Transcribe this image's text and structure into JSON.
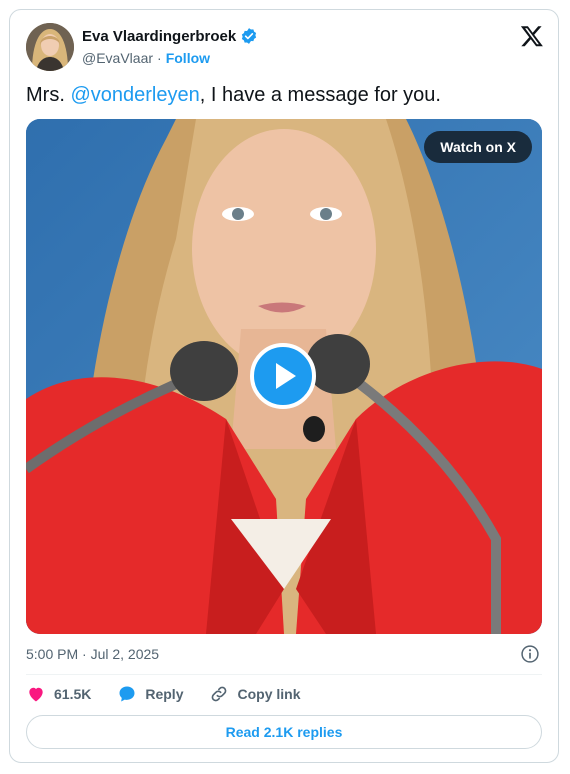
{
  "author": {
    "name": "Eva Vlaardingerbroek",
    "handle": "@EvaVlaar",
    "separator": "·",
    "follow_label": "Follow",
    "verified": true
  },
  "post": {
    "text_prefix": "Mrs. ",
    "mention": "@vonderleyen",
    "text_suffix": ", I have a message for you."
  },
  "media": {
    "watch_label": "Watch on X",
    "play_icon": "play-icon"
  },
  "meta": {
    "timestamp": "5:00 PM · Jul 2, 2025"
  },
  "actions": {
    "likes": "61.5K",
    "reply_label": "Reply",
    "copy_link_label": "Copy link"
  },
  "footer": {
    "read_replies_label": "Read 2.1K replies"
  },
  "colors": {
    "accent": "#1d9bf0",
    "like": "#f91880",
    "text": "#0f1419",
    "muted": "#536471",
    "border": "#cfd9de"
  }
}
